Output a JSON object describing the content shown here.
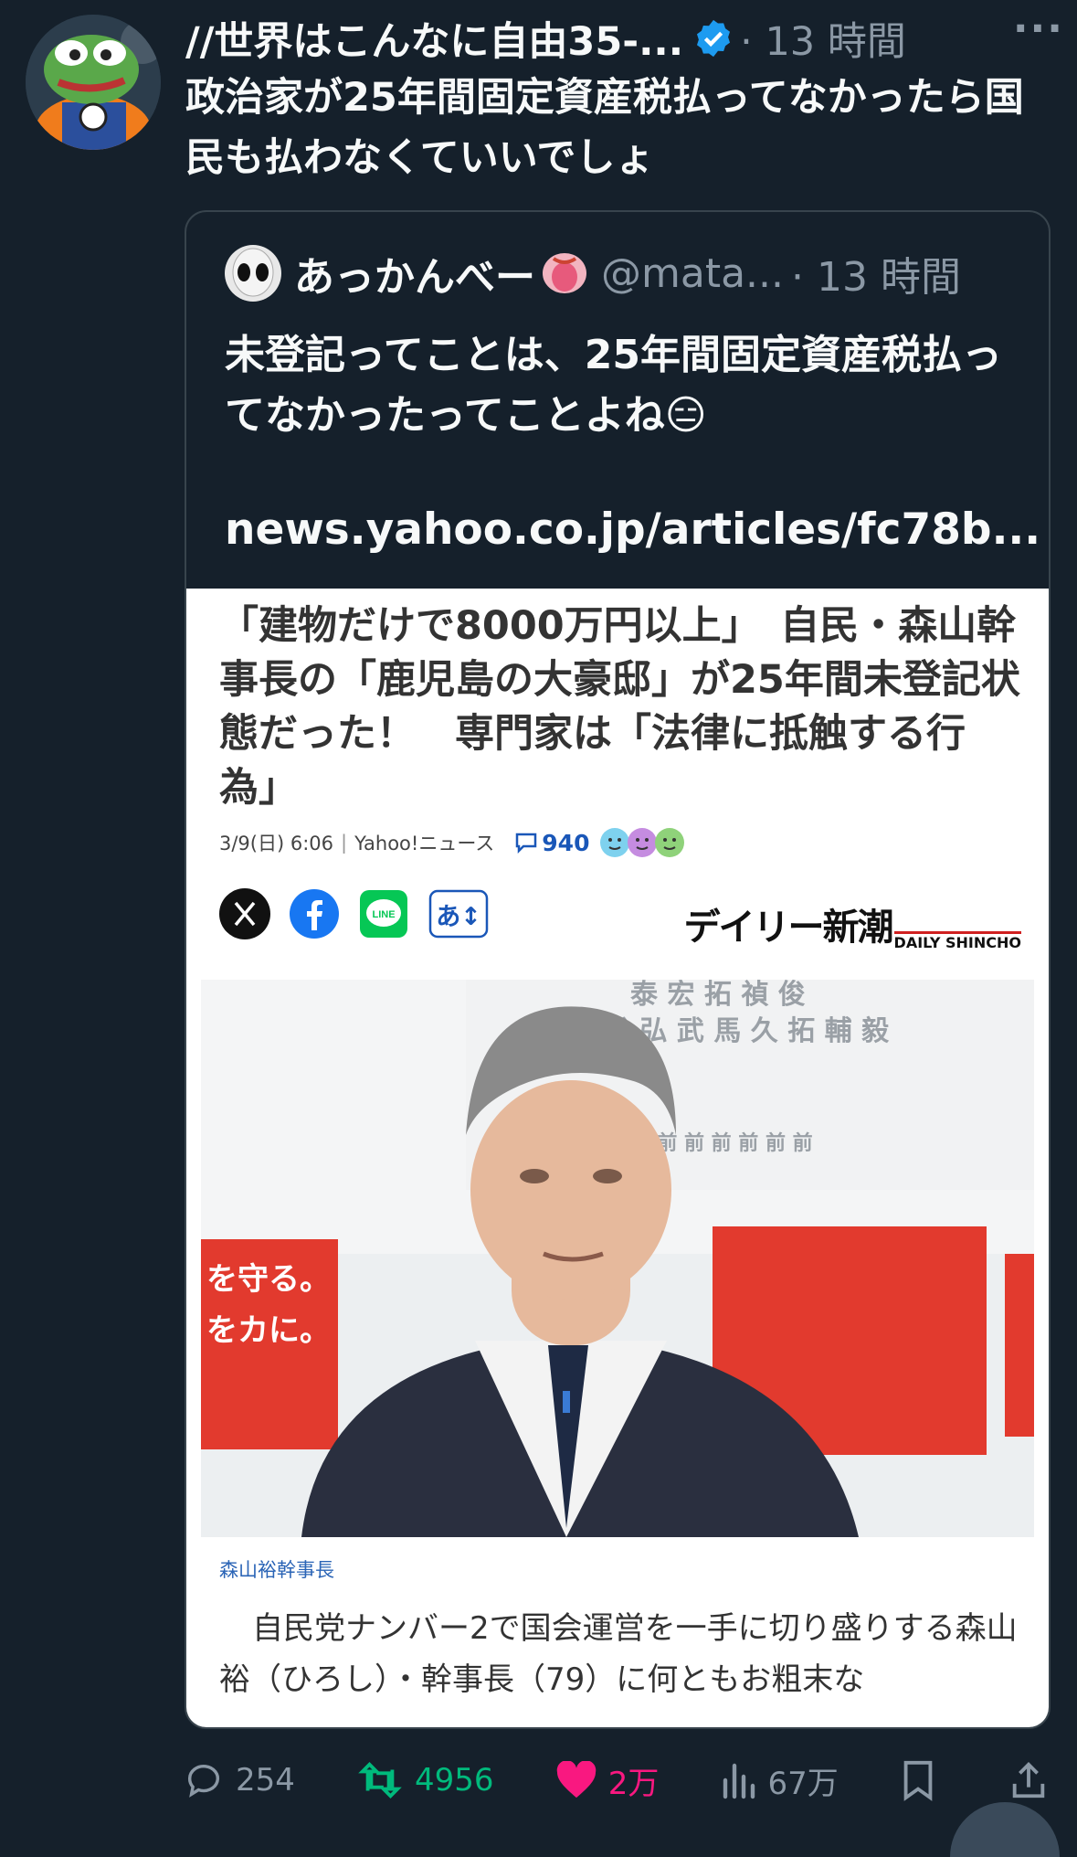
{
  "tweet": {
    "author_name": "//世界はこんなに自由35-...",
    "time": "· 13 時間",
    "more": "···",
    "text": "政治家が25年間固定資産税払ってなかったら国民も払わなくていいでしょ"
  },
  "quote": {
    "author_name": "あっかんべー",
    "handle": "@mata...",
    "time": "· 13 時間",
    "text": "未登記ってことは、25年間固定資産税払ってなかったってことよね😑",
    "link": "news.yahoo.co.jp/articles/fc78b...",
    "article": {
      "title": "「建物だけで8000万円以上」　自民・森山幹事長の「鹿児島の大豪邸」が25年間未登記状態だった！　専門家は「法律に抵触する行為」",
      "date": "3/9(日) 6:06",
      "source": "Yahoo!ニュース",
      "comment_count": "940",
      "translate_label": "あ↕",
      "brand": "デイリー新潮",
      "brand_sub": "DAILY SHINCHO",
      "photo_sign_text": "を守る。\nをカに。",
      "caption": "森山裕幹事長",
      "body": "自民党ナンバー2で国会運営を一手に切り盛りする森山裕（ひろし）・幹事長（79）に何ともお粗末な"
    }
  },
  "actions": {
    "replies": "254",
    "retweets": "4956",
    "likes": "2万",
    "views": "67万"
  },
  "colors": {
    "background": "#15202b",
    "muted": "#8b98a5",
    "verified": "#1d9bf0",
    "retweet": "#00ba7c",
    "like": "#f91880"
  }
}
